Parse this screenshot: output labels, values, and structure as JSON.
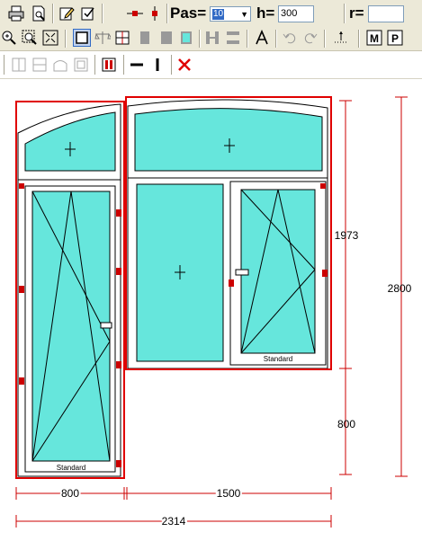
{
  "toolbar": {
    "pas_label": "Pas=",
    "pas_value": "10",
    "h_label": "h=",
    "h_value": "300",
    "r_label": "r=",
    "r_value": ""
  },
  "drawing": {
    "sash_left_label": "Standard",
    "sash_right_label": "Standard",
    "dim_vertical_upper": "1973",
    "dim_vertical_lower": "800",
    "dim_vertical_total": "2800",
    "dim_horizontal_left": "800",
    "dim_horizontal_right": "1500",
    "dim_horizontal_total": "2314"
  },
  "colors": {
    "glass": "#66e6dc",
    "selection": "#e00000",
    "handle": "#cc0000",
    "toolbar_bg": "#ece9d8"
  },
  "icons": [
    "print-icon",
    "print-preview-icon",
    "edit-icon",
    "edit-check-icon",
    "node-horizontal-icon",
    "node-vertical-icon",
    "zoom-in-icon",
    "zoom-area-icon",
    "zoom-fit-icon",
    "rectangle-icon",
    "balance-icon",
    "grid-icon",
    "fill-left-icon",
    "fill-center-icon",
    "fill-right-icon",
    "frame-icon",
    "h-split-icon",
    "v-split-icon",
    "text-icon",
    "undo-icon",
    "redo-icon",
    "dimension-icon",
    "m-icon",
    "p-icon",
    "vsplit-icon",
    "hsplit-icon",
    "arc-icon",
    "inner-frame-icon",
    "double-frame-icon",
    "horizontal-bar-icon",
    "vertical-bar-icon",
    "delete-icon"
  ]
}
